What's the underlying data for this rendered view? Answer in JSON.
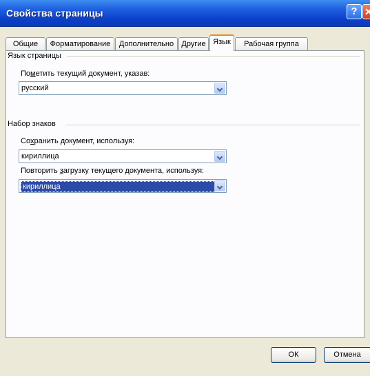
{
  "window": {
    "title": "Свойства страницы"
  },
  "titlebar_buttons": {
    "help": "?"
  },
  "tabs": [
    {
      "label": "Общие"
    },
    {
      "label": "Форматирование"
    },
    {
      "label": "Дополнительно"
    },
    {
      "label": "Другие"
    },
    {
      "label": "Язык",
      "active": true
    },
    {
      "label": "Рабочая группа"
    }
  ],
  "language_group": {
    "title": "Язык страницы",
    "mark_label_pre": "По",
    "mark_label_accel": "м",
    "mark_label_post": "етить текущий документ, указав:",
    "mark_value": "русский"
  },
  "charset_group": {
    "title": "Набор знаков",
    "save_label_pre": "Со",
    "save_label_accel": "х",
    "save_label_post": "ранить документ, используя:",
    "save_value": "кириллица",
    "reload_label_pre": "Повторить ",
    "reload_label_accel": "з",
    "reload_label_post": "агрузку текущего документа, используя:",
    "reload_value": "кириллица"
  },
  "buttons": {
    "ok": "ОК",
    "cancel": "Отмена"
  }
}
